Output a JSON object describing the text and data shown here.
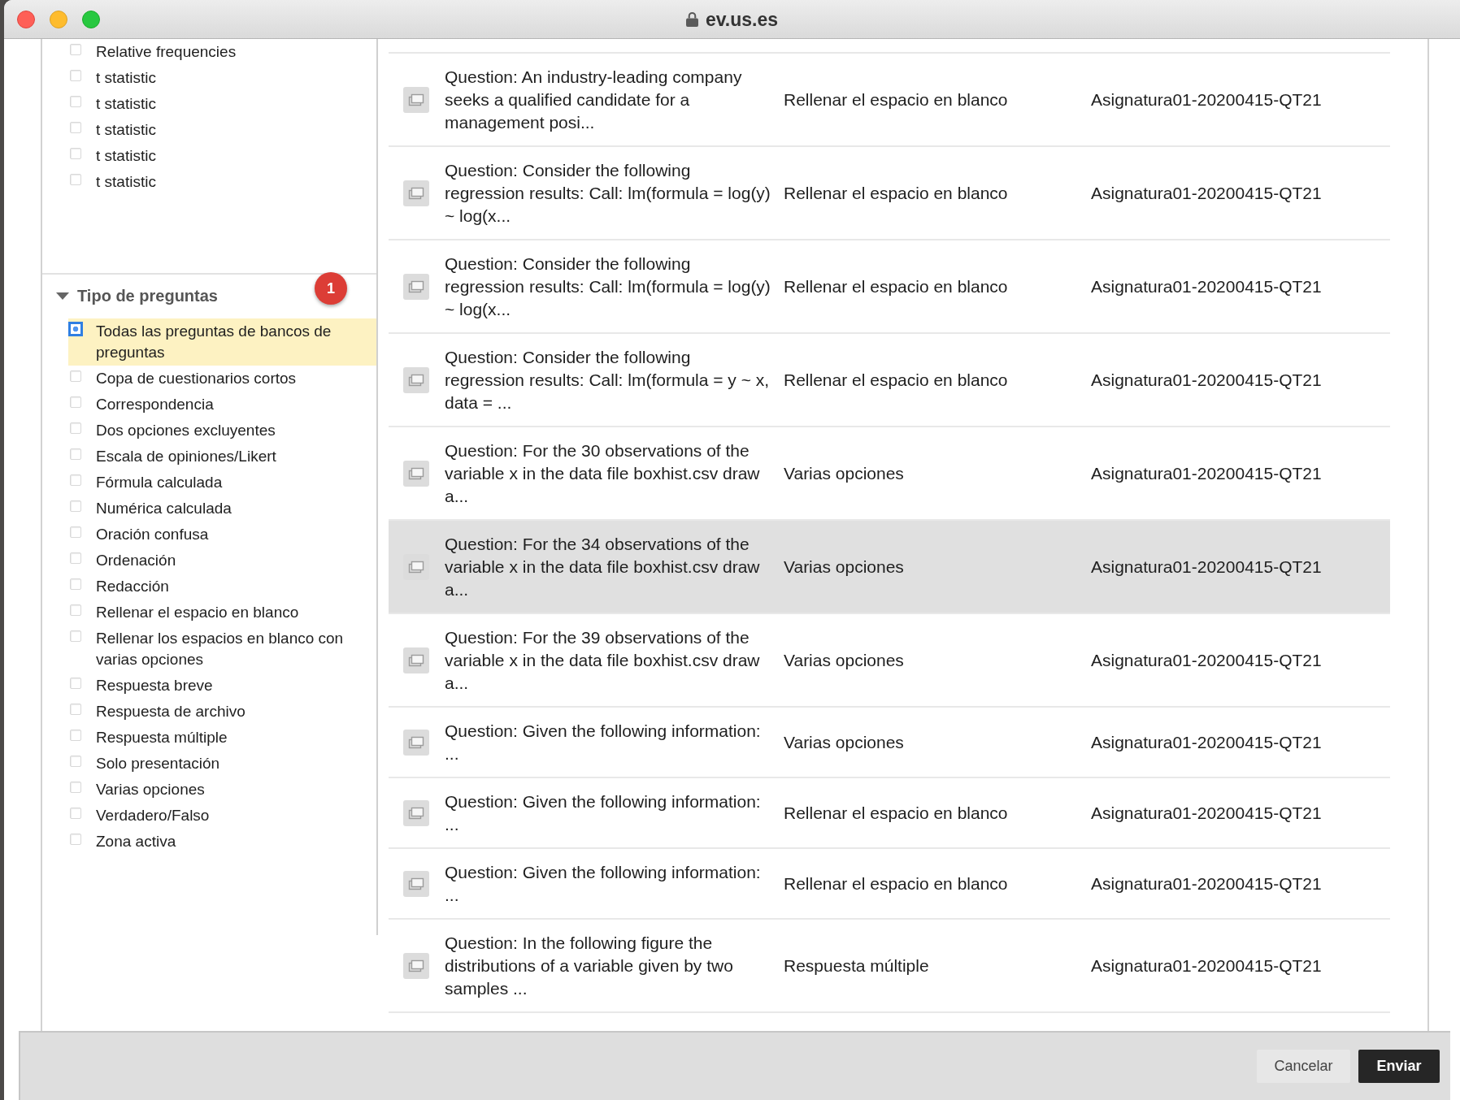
{
  "window": {
    "title": "ev.us.es"
  },
  "sidebar": {
    "attribute_items": [
      {
        "label": "Relative frequencies",
        "checked": false
      },
      {
        "label": "t statistic",
        "checked": false
      },
      {
        "label": "t statistic",
        "checked": false
      },
      {
        "label": "t statistic",
        "checked": false
      },
      {
        "label": "t statistic",
        "checked": false
      },
      {
        "label": "t statistic",
        "checked": false
      }
    ],
    "question_type_section": {
      "title": "Tipo de preguntas",
      "expanded": true,
      "badge": "1",
      "items": [
        {
          "label": "Todas las preguntas de bancos de preguntas",
          "checked": true,
          "selected": true
        },
        {
          "label": "Copa de cuestionarios cortos",
          "checked": false,
          "selected": false
        },
        {
          "label": "Correspondencia",
          "checked": false,
          "selected": false
        },
        {
          "label": "Dos opciones excluyentes",
          "checked": false,
          "selected": false
        },
        {
          "label": "Escala de opiniones/Likert",
          "checked": false,
          "selected": false
        },
        {
          "label": "Fórmula calculada",
          "checked": false,
          "selected": false
        },
        {
          "label": "Numérica calculada",
          "checked": false,
          "selected": false
        },
        {
          "label": "Oración confusa",
          "checked": false,
          "selected": false
        },
        {
          "label": "Ordenación",
          "checked": false,
          "selected": false
        },
        {
          "label": "Redacción",
          "checked": false,
          "selected": false
        },
        {
          "label": "Rellenar el espacio en blanco",
          "checked": false,
          "selected": false
        },
        {
          "label": "Rellenar los espacios en blanco con varias opciones",
          "checked": false,
          "selected": false
        },
        {
          "label": "Respuesta breve",
          "checked": false,
          "selected": false
        },
        {
          "label": "Respuesta de archivo",
          "checked": false,
          "selected": false
        },
        {
          "label": "Respuesta múltiple",
          "checked": false,
          "selected": false
        },
        {
          "label": "Solo presentación",
          "checked": false,
          "selected": false
        },
        {
          "label": "Varias opciones",
          "checked": false,
          "selected": false
        },
        {
          "label": "Verdadero/Falso",
          "checked": false,
          "selected": false
        },
        {
          "label": "Zona activa",
          "checked": false,
          "selected": false
        }
      ]
    }
  },
  "questions": {
    "rows": [
      {
        "column_1": "Question: An industry-leading company seeks a qualified candidate for a management posi...",
        "column_2": "Rellenar el espacio en blanco",
        "column_3": "Asignatura01-20200415-QT21",
        "highlighted": false
      },
      {
        "column_1": "Question: Consider the following regression results: Call: lm(formula = log(y) ~ log(x...",
        "column_2": "Rellenar el espacio en blanco",
        "column_3": "Asignatura01-20200415-QT21",
        "highlighted": false
      },
      {
        "column_1": "Question: Consider the following regression results: Call: lm(formula = log(y) ~ log(x...",
        "column_2": "Rellenar el espacio en blanco",
        "column_3": "Asignatura01-20200415-QT21",
        "highlighted": false
      },
      {
        "column_1": "Question: Consider the following regression results: Call: lm(formula = y ~ x, data = ...",
        "column_2": "Rellenar el espacio en blanco",
        "column_3": "Asignatura01-20200415-QT21",
        "highlighted": false
      },
      {
        "column_1": "Question: For the 30 observations of the variable x in the data file boxhist.csv draw a...",
        "column_2": "Varias opciones",
        "column_3": "Asignatura01-20200415-QT21",
        "highlighted": false
      },
      {
        "column_1": "Question: For the 34 observations of the variable x in the data file boxhist.csv draw a...",
        "column_2": "Varias opciones",
        "column_3": "Asignatura01-20200415-QT21",
        "highlighted": true
      },
      {
        "column_1": "Question: For the 39 observations of the variable x in the data file boxhist.csv draw a...",
        "column_2": "Varias opciones",
        "column_3": "Asignatura01-20200415-QT21",
        "highlighted": false
      },
      {
        "column_1": "Question: Given the following information: ...",
        "column_2": "Varias opciones",
        "column_3": "Asignatura01-20200415-QT21",
        "highlighted": false
      },
      {
        "column_1": "Question: Given the following information: ...",
        "column_2": "Rellenar el espacio en blanco",
        "column_3": "Asignatura01-20200415-QT21",
        "highlighted": false
      },
      {
        "column_1": "Question: Given the following information: ...",
        "column_2": "Rellenar el espacio en blanco",
        "column_3": "Asignatura01-20200415-QT21",
        "highlighted": false
      },
      {
        "column_1": "Question: In the following figure the distributions of a variable given by two samples ...",
        "column_2": "Respuesta múltiple",
        "column_3": "Asignatura01-20200415-QT21",
        "highlighted": false
      }
    ]
  },
  "footer": {
    "buttons": [
      {
        "label": "Cancelar",
        "kind": "secondary"
      },
      {
        "label": "Enviar",
        "kind": "primary"
      }
    ]
  }
}
